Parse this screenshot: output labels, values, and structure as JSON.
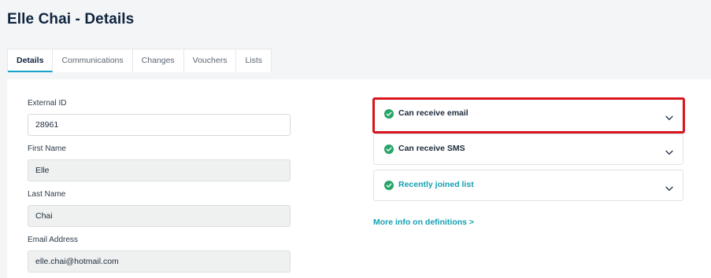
{
  "header": {
    "title": "Elle Chai - Details"
  },
  "tabs": [
    {
      "label": "Details",
      "active": true
    },
    {
      "label": "Communications",
      "active": false
    },
    {
      "label": "Changes",
      "active": false
    },
    {
      "label": "Vouchers",
      "active": false
    },
    {
      "label": "Lists",
      "active": false
    }
  ],
  "form": {
    "external_id": {
      "label": "External ID",
      "value": "28961"
    },
    "first_name": {
      "label": "First Name",
      "value": "Elle"
    },
    "last_name": {
      "label": "Last Name",
      "value": "Chai"
    },
    "email": {
      "label": "Email Address",
      "value": "elle.chai@hotmail.com"
    }
  },
  "statuses": [
    {
      "label": "Can receive email",
      "icon": "check-circle-icon",
      "highlighted": true
    },
    {
      "label": "Can receive SMS",
      "icon": "check-circle-icon",
      "highlighted": false
    },
    {
      "label": "Recently joined list",
      "icon": "check-circle-icon",
      "highlighted": false
    }
  ],
  "more_info_link": "More info on definitions >",
  "colors": {
    "accent": "#13a4c9",
    "teal_text": "#139fb2",
    "success": "#27a567",
    "highlight_border": "#d8141c",
    "title": "#0f2440"
  }
}
